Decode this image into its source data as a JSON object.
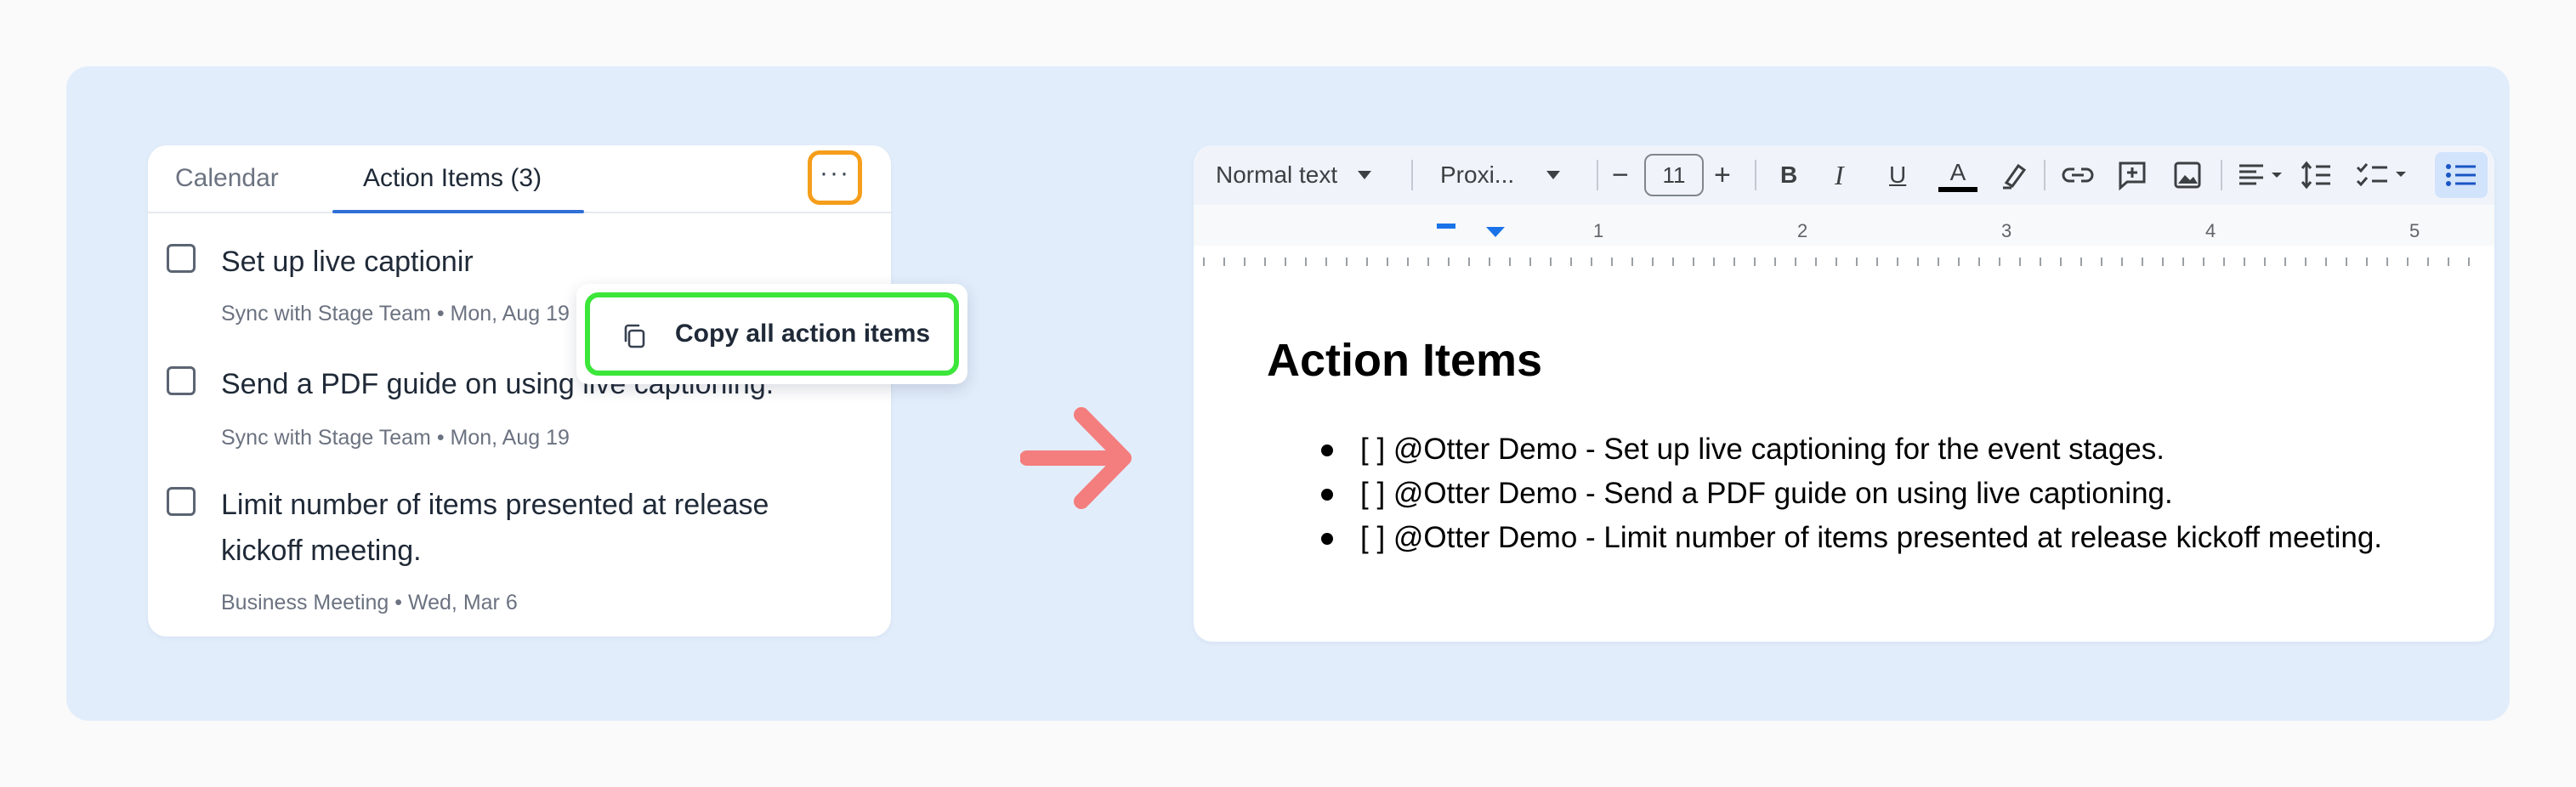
{
  "left_panel": {
    "tabs": [
      {
        "label": "Calendar"
      },
      {
        "label": "Action Items (3)"
      }
    ],
    "more_label": "···",
    "action_items": [
      {
        "text": "Set up live captionir",
        "meta": "Sync with Stage Team • Mon, Aug 19"
      },
      {
        "text": "Send a PDF guide on using live captioning.",
        "meta": "Sync with Stage Team • Mon, Aug 19"
      },
      {
        "text": "Limit number of items presented at release kickoff meeting.",
        "meta": "Business Meeting • Wed, Mar 6"
      }
    ],
    "menu": {
      "copy_label": "Copy all action items"
    }
  },
  "doc": {
    "toolbar": {
      "style": "Normal text",
      "font": "Proxi...",
      "font_size": "11",
      "minus": "−",
      "plus": "+",
      "bold": "B",
      "italic": "I",
      "underline": "U",
      "text_color": "A"
    },
    "ruler_numbers": [
      "1",
      "2",
      "3",
      "4",
      "5"
    ],
    "title": "Action Items",
    "items": [
      "[ ] @Otter Demo - Set up live captioning for the event stages.",
      "[ ] @Otter Demo - Send a PDF guide on using live captioning.",
      "[ ] @Otter Demo - Limit number of items presented at release kickoff meeting."
    ]
  },
  "colors": {
    "background_panel": "#e2edfb",
    "highlight_orange": "#f59e1b",
    "highlight_green": "#3ce63a",
    "arrow": "#f47d7d",
    "tab_active": "#2f6fd6"
  }
}
